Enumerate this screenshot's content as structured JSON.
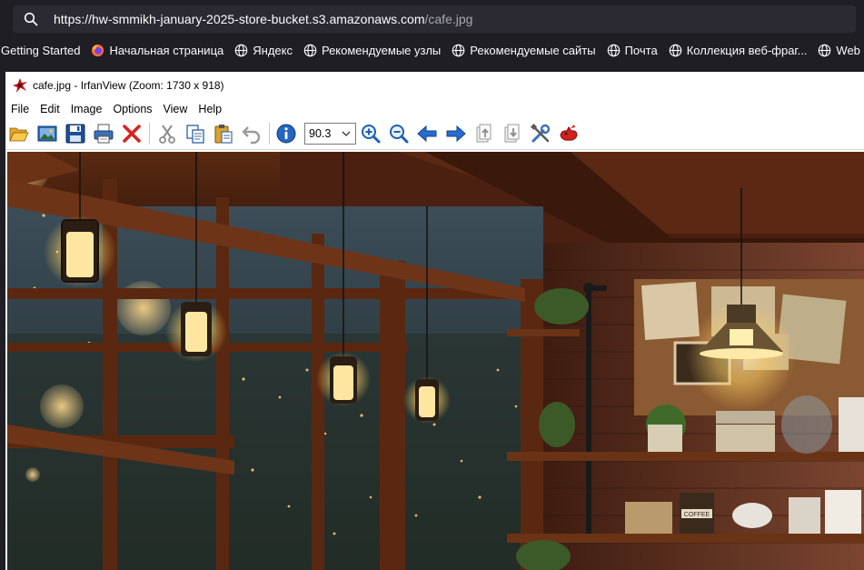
{
  "browser": {
    "url_host": "https://hw-smmikh-january-2025-store-bucket.s3.amazonaws.com",
    "url_path": "/cafe.jpg",
    "bookmarks": [
      {
        "label": "Getting Started",
        "icon": "none"
      },
      {
        "label": "Начальная страница",
        "icon": "firefox-icon"
      },
      {
        "label": "Яндекс",
        "icon": "globe-icon"
      },
      {
        "label": "Рекомендуемые узлы",
        "icon": "globe-icon"
      },
      {
        "label": "Рекомендуемые сайты",
        "icon": "globe-icon"
      },
      {
        "label": "Почта",
        "icon": "globe-icon"
      },
      {
        "label": "Коллекция веб-фраг...",
        "icon": "globe-icon"
      },
      {
        "label": "Web Slice Gallery",
        "icon": "globe-icon"
      }
    ]
  },
  "irfanview": {
    "title": "cafe.jpg - IrfanView (Zoom: 1730 x 918)",
    "menu": [
      "File",
      "Edit",
      "Image",
      "Options",
      "View",
      "Help"
    ],
    "zoom_value": "90.3",
    "toolbar_icons": [
      "open-folder-icon",
      "thumbnails-icon",
      "save-icon",
      "print-icon",
      "delete-icon",
      "cut-icon",
      "copy-icon",
      "paste-icon",
      "undo-icon",
      "info-icon",
      "zoom-in-icon",
      "zoom-out-icon",
      "previous-icon",
      "next-icon",
      "first-page-icon",
      "last-page-icon",
      "settings-icon",
      "irfanview-logo-icon"
    ],
    "image_label": "COFFEE"
  }
}
